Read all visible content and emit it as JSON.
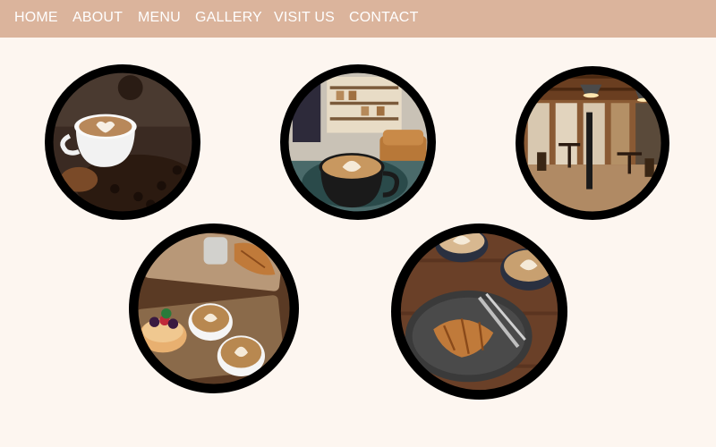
{
  "nav": {
    "items": [
      {
        "label": "HOME"
      },
      {
        "label": "ABOUT"
      },
      {
        "label": "MENU"
      },
      {
        "label": "GALLERY"
      },
      {
        "label": "VISIT US"
      },
      {
        "label": "CONTACT"
      }
    ]
  },
  "colors": {
    "navbar": "#dbb49c",
    "nav_text": "#ffffff",
    "page_background": "#fdf6f0",
    "photo_border": "#000000"
  },
  "gallery": {
    "photos": [
      {
        "subject": "latte-art-cup-on-coffee-beans"
      },
      {
        "subject": "latte-in-cafe-interior"
      },
      {
        "subject": "cafe-dining-room-interior"
      },
      {
        "subject": "lattes-with-pastries-on-board"
      },
      {
        "subject": "croissant-and-lattes-on-table"
      }
    ]
  }
}
